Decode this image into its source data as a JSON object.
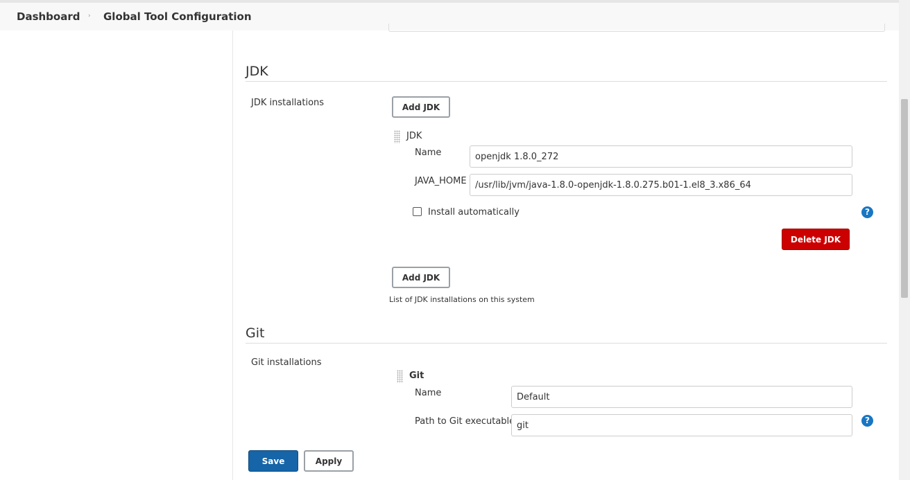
{
  "breadcrumb": {
    "dashboard": "Dashboard",
    "separator": "›",
    "current": "Global Tool Configuration"
  },
  "jdk": {
    "title": "JDK",
    "installations_label": "JDK installations",
    "add_button": "Add JDK",
    "entry": {
      "header": "JDK",
      "name_label": "Name",
      "name_value": "openjdk 1.8.0_272",
      "java_home_label": "JAVA_HOME",
      "java_home_value": "/usr/lib/jvm/java-1.8.0-openjdk-1.8.0.275.b01-1.el8_3.x86_64",
      "install_auto_label": "Install automatically",
      "install_auto_checked": false,
      "delete_button": "Delete JDK"
    },
    "add_button_bottom": "Add JDK",
    "description": "List of JDK installations on this system"
  },
  "git": {
    "title": "Git",
    "installations_label": "Git installations",
    "entry": {
      "header": "Git",
      "name_label": "Name",
      "name_value": "Default",
      "path_label": "Path to Git executable",
      "path_value": "git"
    }
  },
  "footer": {
    "save": "Save",
    "apply": "Apply"
  },
  "help_icon_text": "?",
  "colors": {
    "accent": "#1565a8",
    "danger": "#cc0000",
    "help": "#1976c2"
  }
}
